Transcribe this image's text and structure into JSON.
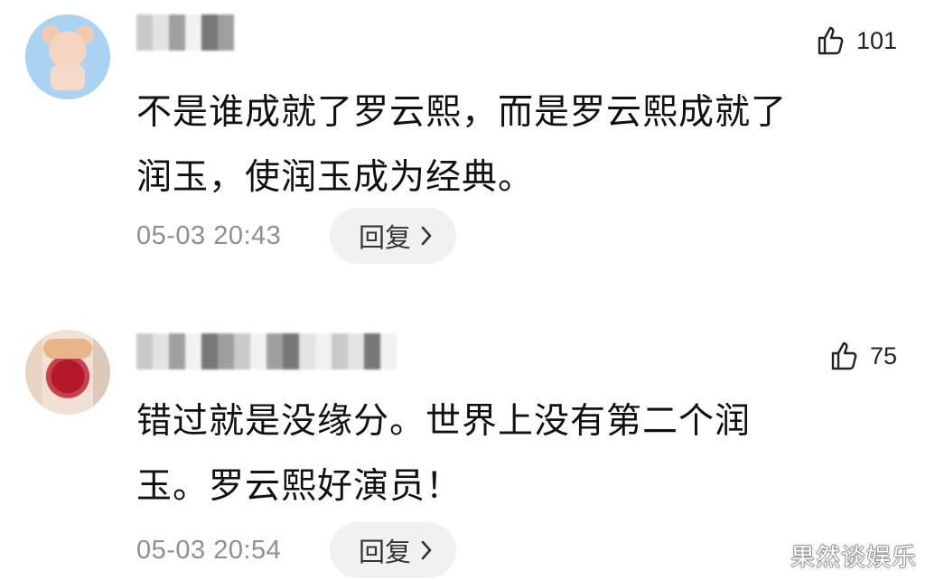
{
  "comments": [
    {
      "likes": "101",
      "text_line_1": "不是谁成就了罗云熙，而是罗云熙成就了",
      "text_line_2": "润玉，使润玉成为经典。",
      "timestamp": "05-03 20:43",
      "reply_label": "回复"
    },
    {
      "likes": "75",
      "text_line_1": "错过就是没缘分。世界上没有第二个润",
      "text_line_2": "玉。罗云熙好演员！",
      "timestamp": "05-03 20:54",
      "reply_label": "回复"
    }
  ],
  "watermark": "果然谈娱乐",
  "icons": {
    "like": "thumbs-up-icon",
    "reply": "chevron-right-icon"
  },
  "colors": {
    "background": "#ffffff",
    "text": "#111111",
    "muted": "#8f8f8f",
    "reply_bg": "#f1f1f1"
  }
}
